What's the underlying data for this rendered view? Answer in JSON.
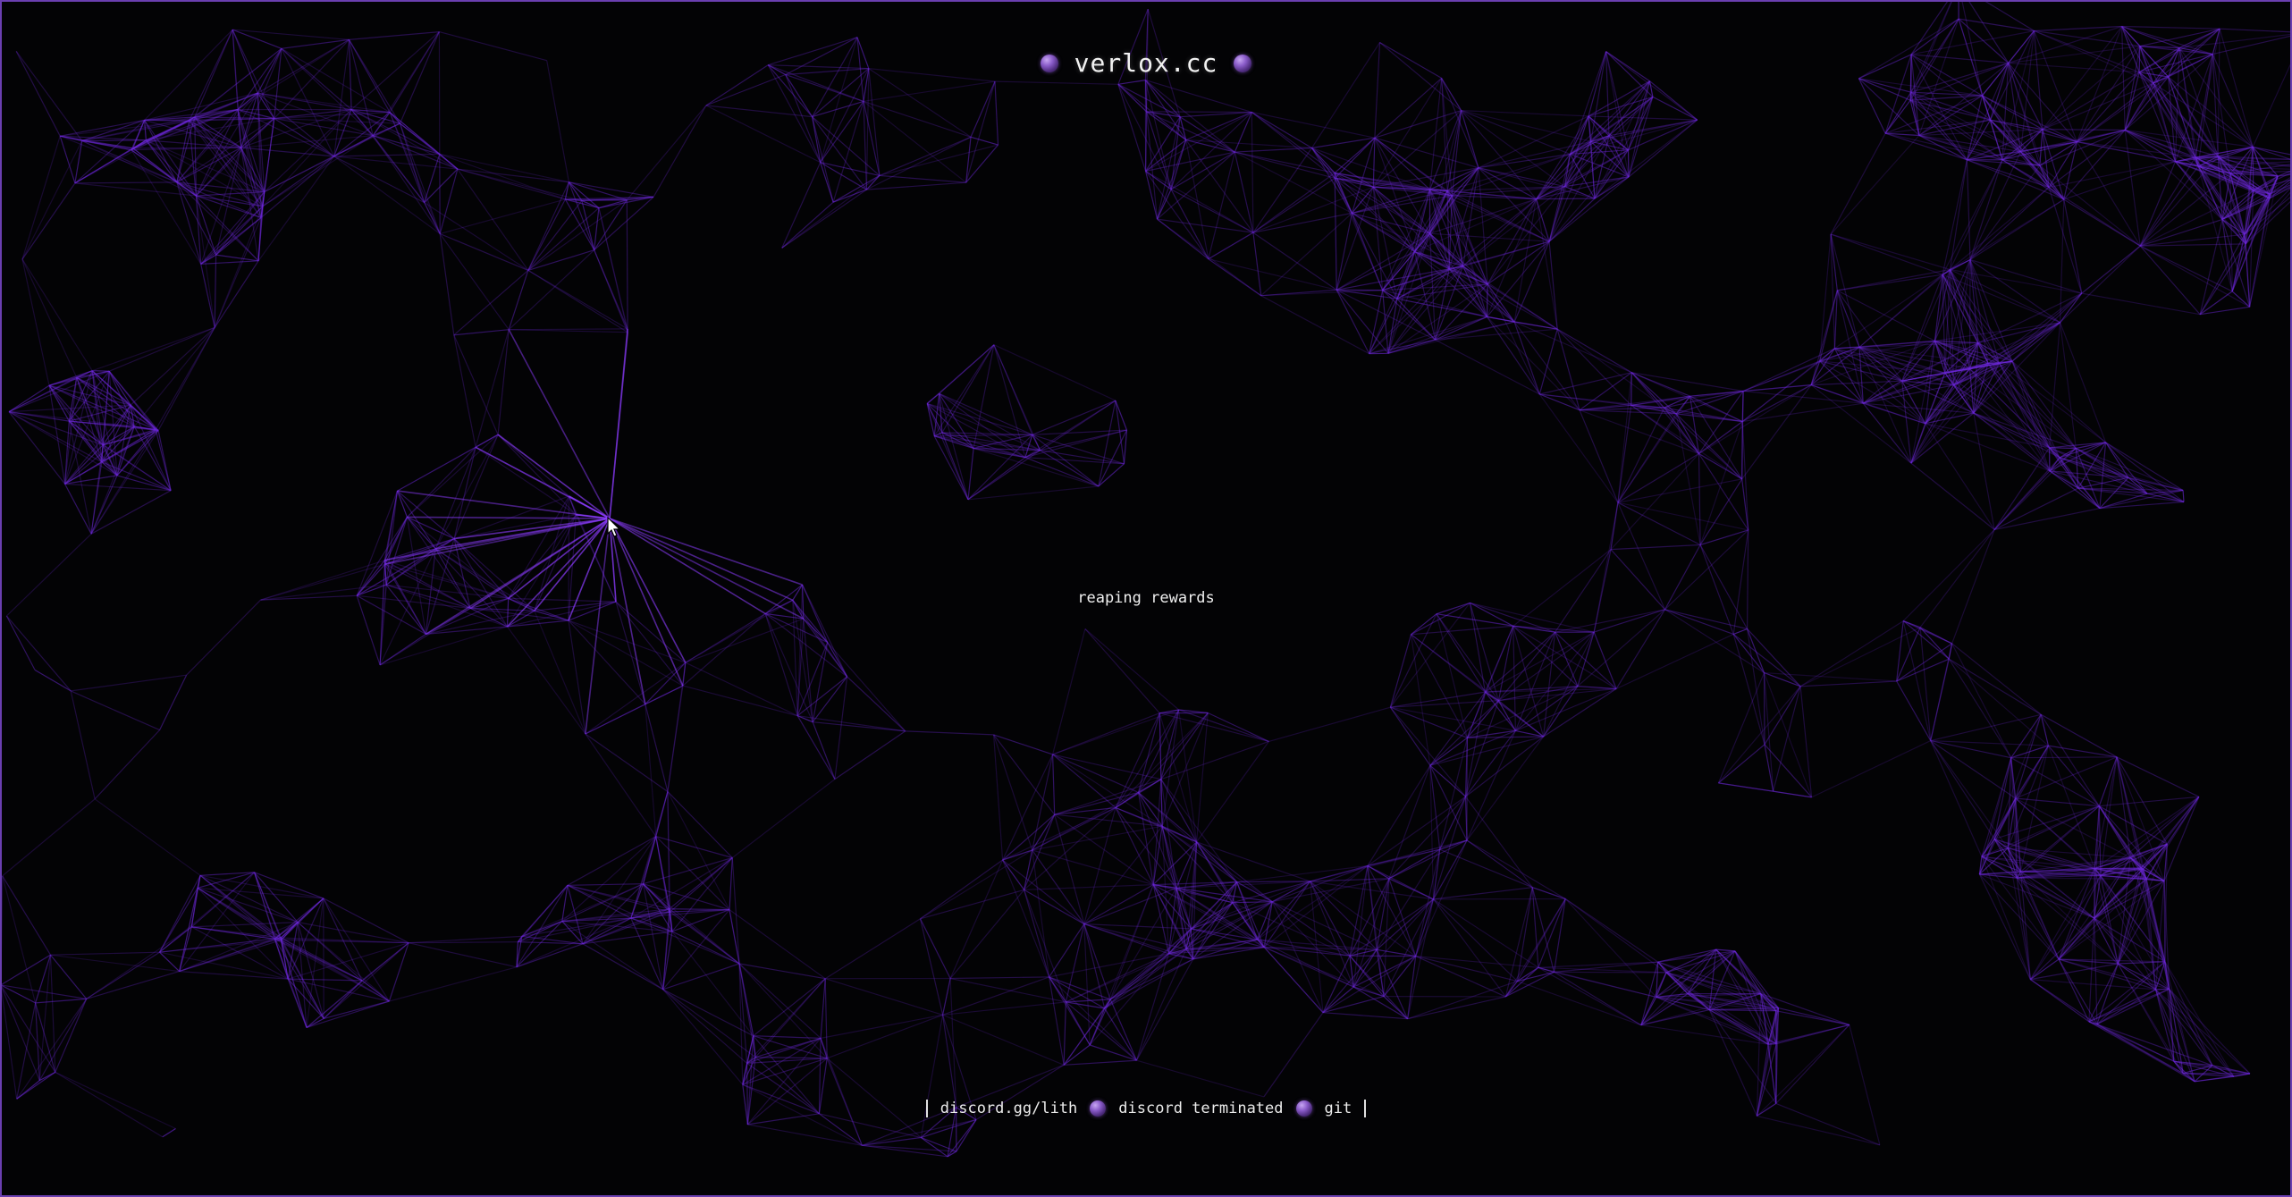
{
  "header": {
    "title": "verlox.cc",
    "left_icon": "gem-icon",
    "right_icon": "gem-icon"
  },
  "main": {
    "status_text": "reaping rewards"
  },
  "footer": {
    "links": [
      {
        "label": "discord.gg/lith"
      },
      {
        "label": "discord terminated"
      },
      {
        "label": "git"
      }
    ],
    "separator_icon": "gem-icon"
  },
  "colors": {
    "background": "#030305",
    "accent": "#7b2ff0",
    "border": "#6a3fb0",
    "text": "#f2f2f2"
  }
}
